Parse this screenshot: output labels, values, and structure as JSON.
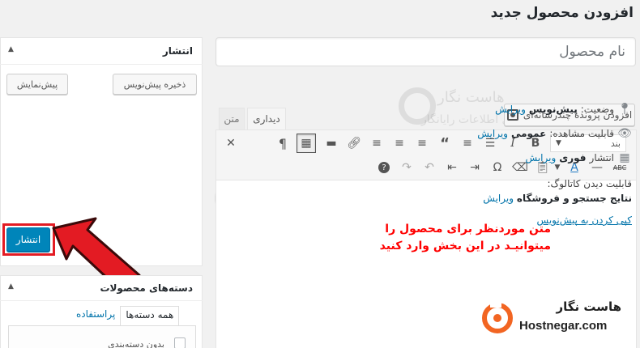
{
  "page": {
    "title": "افزودن محصول جدید",
    "product_name_placeholder": "نام محصول"
  },
  "editor": {
    "add_media_label": "افزودن پروندهٔ چندرسانه‌ای",
    "tabs": [
      {
        "label": "دیداری",
        "active": true
      },
      {
        "label": "متن",
        "active": false
      }
    ],
    "format_select_value": "بند",
    "toolbar_row1": [
      "B",
      "I",
      "bulleted-list",
      "numbered-list",
      "blockquote",
      "align-left",
      "align-center",
      "align-right",
      "link",
      "read-more",
      "toolbar-toggle",
      "paragraph",
      "fullscreen"
    ],
    "toolbar_row2": [
      "abc-strikethrough",
      "horizontal-line",
      "text-color",
      "paste-as-text",
      "clear-formatting",
      "special-character",
      "outdent",
      "indent",
      "undo",
      "redo",
      "help"
    ],
    "annotation_line1": "متن موردنظر برای محصول را",
    "annotation_line2": "میتوانیـد در این بخش وارد کنید"
  },
  "publish": {
    "title": "انتشار",
    "save_draft_label": "ذخیره پیش‌نویس",
    "preview_label": "پیش‌نمایش",
    "status_label": "وضعیت:",
    "status_value": "پیش‌نویس",
    "status_edit": "ویرایش",
    "visibility_label": "قابلیت مشاهده:",
    "visibility_value": "عمومی",
    "visibility_edit": "ویرایش",
    "publish_time_label": "انتشار",
    "publish_time_value": "فوری",
    "publish_time_edit": "ویرایش",
    "catalog_label": "قابلیت دیدن کاتالوگ:",
    "catalog_value": "نتایج جستجو و فروشگاه",
    "catalog_edit": "ویرایش",
    "trash_label": "کپی کردن به پیش‌نویس",
    "publish_button": "انتشار"
  },
  "categories": {
    "title": "دسته‌های محصولات",
    "tab_all": "همه دسته‌ها",
    "tab_popular": "پراستفاده",
    "first_item": "بدون دسته‌بندی"
  },
  "brand": {
    "name_fa": "هاست نگار",
    "name_en": "Hostnegar.com"
  },
  "watermark": {
    "line1": "هاست نگار",
    "line2": "فناوری اطلاعات رایانگار"
  },
  "colors": {
    "primary_button": "#0085ba",
    "link": "#0073aa",
    "highlight_red": "#e31b23",
    "annotation_red": "#ff0000",
    "brand_orange": "#f26522"
  }
}
